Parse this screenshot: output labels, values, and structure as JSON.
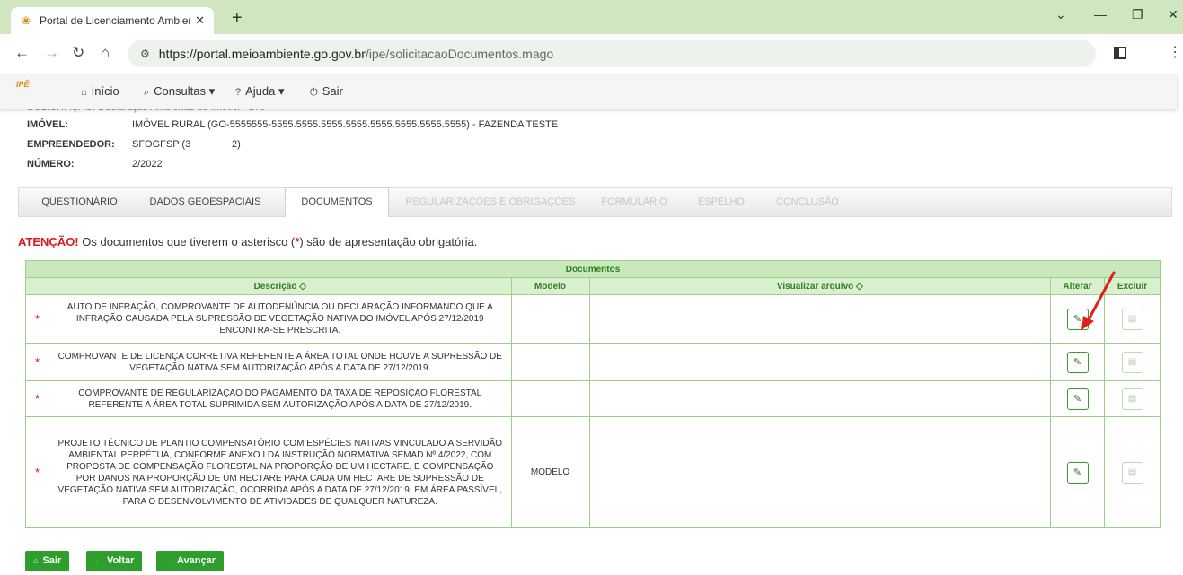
{
  "browser": {
    "tab_title": "Portal de Licenciamento Ambien",
    "tab_close": "✕",
    "new_tab": "+",
    "url_host": "https://portal.meioambiente.go.gov.br",
    "url_path": "/ipe/solicitacaoDocumentos.mago"
  },
  "appnav": {
    "logo": "IPÊ",
    "items": [
      {
        "icon": "⌂",
        "label": "Início"
      },
      {
        "icon": "⌕",
        "label": "Consultas ▾"
      },
      {
        "icon": "?",
        "label": "Ajuda ▾"
      },
      {
        "icon": "⏻",
        "label": "Sair"
      }
    ]
  },
  "info": {
    "clipped": "SOLICITAÇÃO: Declaração Ambiental do Imóvel - DAI",
    "imovel_label": "IMÓVEL:",
    "imovel_value": "IMÓVEL RURAL (GO-5555555-5555.5555.5555.5555.5555.5555.5555.5555) - FAZENDA TESTE",
    "empreendedor_label": "EMPREENDEDOR:",
    "empreendedor_value": "SFOGFSP (3               2)",
    "numero_label": "NÚMERO:",
    "numero_value": "2/2022"
  },
  "tabs": [
    {
      "label": "QUESTIONÁRIO",
      "state": "normal"
    },
    {
      "label": "DADOS GEOESPACIAIS",
      "state": "normal"
    },
    {
      "label": "DOCUMENTOS",
      "state": "active"
    },
    {
      "label": "REGULARIZAÇÕES E OBRIGAÇÕES",
      "state": "disabled"
    },
    {
      "label": "FORMULÁRIO",
      "state": "disabled"
    },
    {
      "label": "ESPELHO",
      "state": "disabled"
    },
    {
      "label": "CONCLUSÃO",
      "state": "disabled"
    }
  ],
  "warning": {
    "prefix": "ATENÇÃO!",
    "text1": " Os documentos que tiverem o asterisco (",
    "star": "*",
    "text2": ") são de apresentação obrigatória."
  },
  "table": {
    "caption": "Documentos",
    "headers": {
      "descricao": "Descrição ◇",
      "modelo": "Modelo",
      "visualizar": "Visualizar arquivo ◇",
      "alterar": "Alterar",
      "excluir": "Excluir"
    },
    "rows": [
      {
        "required": "*",
        "descricao": "AUTO DE INFRAÇÃO, COMPROVANTE DE AUTODENÚNCIA OU DECLARAÇÃO INFORMANDO QUE A INFRAÇÃO CAUSADA PELA SUPRESSÃO DE VEGETAÇÃO NATIVA DO IMÓVEL APÓS 27/12/2019 ENCONTRA-SE PRESCRITA.",
        "modelo": ""
      },
      {
        "required": "*",
        "descricao": "COMPROVANTE DE LICENÇA CORRETIVA REFERENTE A ÁREA TOTAL ONDE HOUVE A SUPRESSÃO DE VEGETAÇÃO NATIVA SEM AUTORIZAÇÃO APÓS A DATA DE 27/12/2019.",
        "modelo": ""
      },
      {
        "required": "*",
        "descricao": "COMPROVANTE DE REGULARIZAÇÃO DO PAGAMENTO DA TAXA DE REPOSIÇÃO FLORESTAL REFERENTE A ÁREA TOTAL SUPRIMIDA SEM AUTORIZAÇÃO APÓS A DATA DE 27/12/2019.",
        "modelo": ""
      },
      {
        "required": "*",
        "descricao": "PROJETO TÉCNICO DE PLANTIO COMPENSATÓRIO COM ESPÉCIES NATIVAS VINCULADO A SERVIDÃO AMBIENTAL PERPÉTUA, CONFORME ANEXO I DA INSTRUÇÃO NORMATIVA SEMAD Nº 4/2022, COM PROPOSTA DE COMPENSAÇÃO FLORESTAL NA PROPORÇÃO DE UM HECTARE, E COMPENSAÇÃO POR DANOS NA PROPORÇÃO DE UM HECTARE PARA CADA UM HECTARE DE SUPRESSÃO DE VEGETAÇÃO NATIVA SEM AUTORIZAÇÃO, OCORRIDA APÓS A DATA DE 27/12/2019, EM ÁREA PASSÍVEL, PARA O DESENVOLVIMENTO DE ATIVIDADES DE QUALQUER NATUREZA.",
        "modelo": "MODELO"
      }
    ]
  },
  "buttons": {
    "sair": "Sair",
    "voltar": "Voltar",
    "avancar": "Avançar"
  },
  "colors": {
    "accent_green": "#2e9e2c",
    "table_border": "#9ccf8a",
    "warning_red": "#d71a1a",
    "annotation_arrow": "#e0201a"
  }
}
